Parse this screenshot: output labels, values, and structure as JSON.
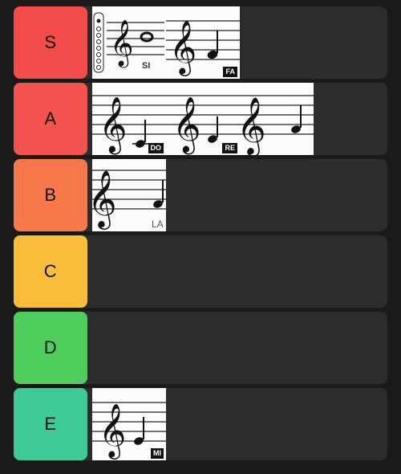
{
  "tiers": [
    {
      "label": "S",
      "color": "#f34a4a",
      "items": [
        {
          "name": "si-note-card",
          "caption": "SI",
          "caption_style": "plain-bold"
        },
        {
          "name": "fa-note-card",
          "caption": "FA",
          "caption_style": "tag"
        }
      ]
    },
    {
      "label": "A",
      "color": "#f4544f",
      "items": [
        {
          "name": "do-note-card",
          "caption": "DO",
          "caption_style": "tag"
        },
        {
          "name": "re-note-card",
          "caption": "RE",
          "caption_style": "tag"
        },
        {
          "name": "sol-note-card",
          "caption": "",
          "caption_style": "none"
        }
      ]
    },
    {
      "label": "B",
      "color": "#f6794c",
      "items": [
        {
          "name": "la-note-card",
          "caption": "LA",
          "caption_style": "plain"
        }
      ]
    },
    {
      "label": "C",
      "color": "#f8bd3a",
      "items": []
    },
    {
      "label": "D",
      "color": "#4fce5e",
      "items": []
    },
    {
      "label": "E",
      "color": "#3fcb96",
      "items": [
        {
          "name": "mi-note-card",
          "caption": "MI",
          "caption_style": "tag"
        }
      ]
    }
  ]
}
